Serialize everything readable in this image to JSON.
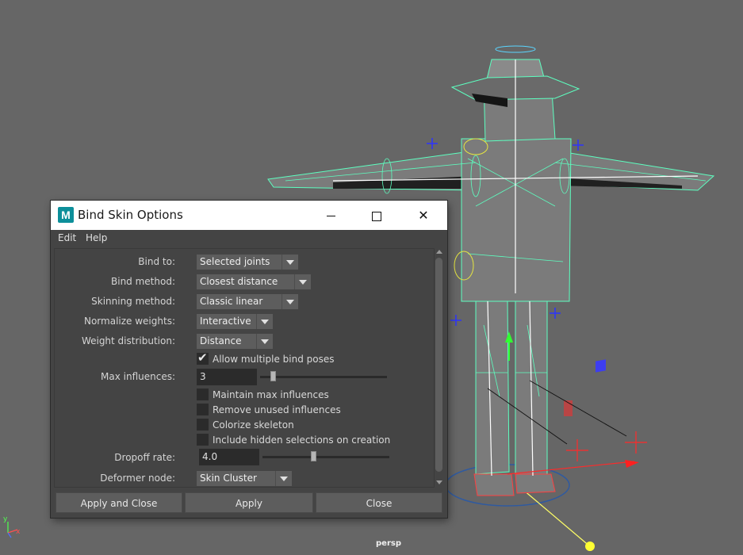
{
  "viewport": {
    "camera_label": "persp",
    "axis_y": "y",
    "axis_x": "x"
  },
  "window": {
    "title": "Bind Skin Options",
    "app_icon_letter": "M"
  },
  "menu": {
    "items": [
      "Edit",
      "Help"
    ]
  },
  "options": {
    "bind_to": {
      "label": "Bind to:",
      "value": "Selected joints"
    },
    "bind_method": {
      "label": "Bind method:",
      "value": "Closest distance"
    },
    "skinning_method": {
      "label": "Skinning method:",
      "value": "Classic linear"
    },
    "normalize_weights": {
      "label": "Normalize weights:",
      "value": "Interactive"
    },
    "weight_distribution": {
      "label": "Weight distribution:",
      "value": "Distance"
    },
    "allow_multiple_bind_poses": {
      "label": "Allow multiple bind poses",
      "checked": true
    },
    "max_influences": {
      "label": "Max influences:",
      "value": "3",
      "slider_fraction": 0.1
    },
    "maintain_max_influences": {
      "label": "Maintain max influences",
      "checked": false
    },
    "remove_unused_influences": {
      "label": "Remove unused influences",
      "checked": false
    },
    "colorize_skeleton": {
      "label": "Colorize skeleton",
      "checked": false
    },
    "include_hidden_selections": {
      "label": "Include hidden selections on creation",
      "checked": false
    },
    "dropoff_rate": {
      "label": "Dropoff rate:",
      "value": "4.0",
      "slider_fraction": 0.4
    },
    "deformer_node": {
      "label": "Deformer node:",
      "value": "Skin Cluster"
    }
  },
  "buttons": {
    "apply_and_close": "Apply and Close",
    "apply": "Apply",
    "close": "Close"
  },
  "colors": {
    "wireframe": "#5dffc0",
    "mesh": "#7b7b7b",
    "viewport_bg": "#666666",
    "dialog_bg": "#444444"
  }
}
